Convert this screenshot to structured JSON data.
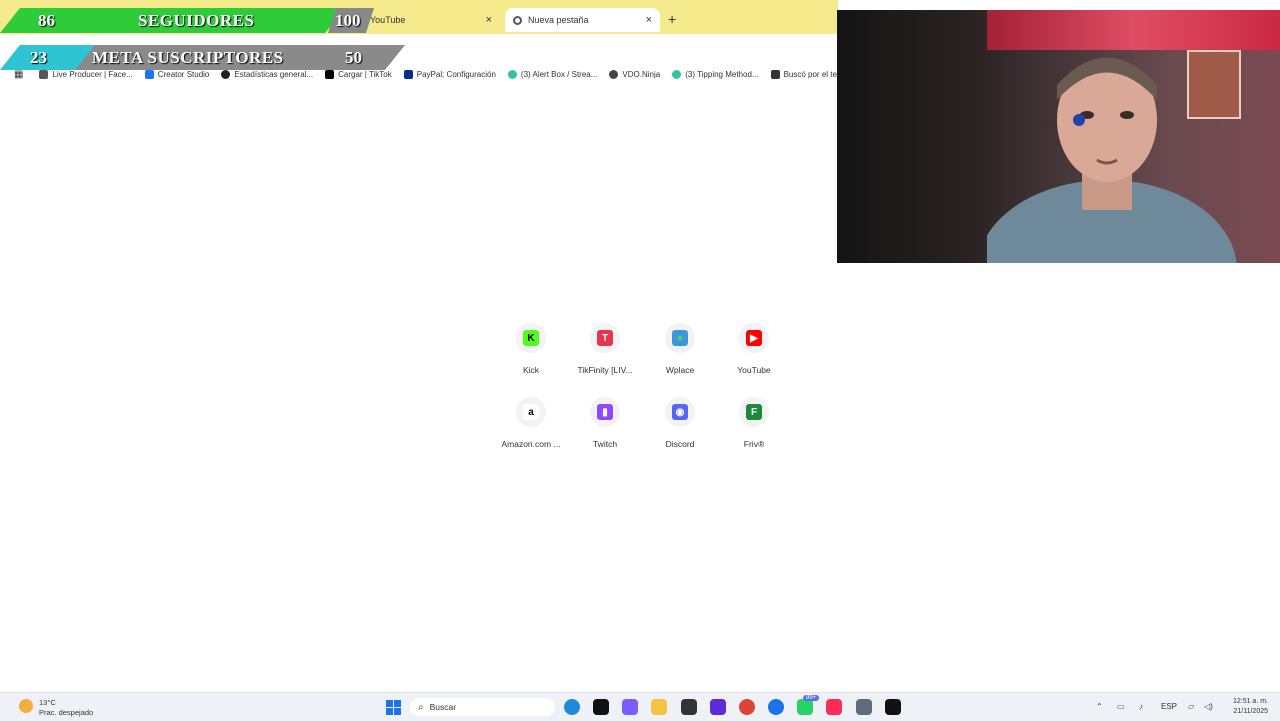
{
  "browser": {
    "tabs": [
      {
        "label": "YouTube",
        "active": false
      },
      {
        "label": "Nueva pestaña",
        "active": true
      }
    ],
    "new_tab_glyph": "+",
    "close_glyph": "×",
    "bookmarks": [
      {
        "label": "Live Producer | Face...",
        "color": "#555555"
      },
      {
        "label": "Creator Studio",
        "color": "#1877f2"
      },
      {
        "label": "Estadísticas general...",
        "color": "#222222"
      },
      {
        "label": "Cargar | TikTok",
        "color": "#000000"
      },
      {
        "label": "PayPal: Configuración",
        "color": "#003087"
      },
      {
        "label": "(3) Alert Box / Strea...",
        "color": "#31c3a2"
      },
      {
        "label": "VDO.Ninja",
        "color": "#444444"
      },
      {
        "label": "(3) Tipping Method...",
        "color": "#31c3a2"
      },
      {
        "label": "Buscó por el te",
        "color": "#333333"
      }
    ]
  },
  "overlay": {
    "followers": {
      "current": "86",
      "title": "SEGUIDORES",
      "goal": "100"
    },
    "subscribers": {
      "current": "23",
      "title": "META SUSCRIPTORES",
      "goal": "50"
    }
  },
  "shortcuts": [
    {
      "label": "Kick",
      "icon": "kick-icon",
      "color": "#53fc18",
      "glyph": "K",
      "glyph_color": "#000000"
    },
    {
      "label": "TikFinity [LIV...",
      "icon": "tikfinity-icon",
      "color": "#e8344e",
      "glyph": "T",
      "glyph_color": "#ffffff"
    },
    {
      "label": "Wplace",
      "icon": "globe-icon",
      "color": "#3a9ad9",
      "glyph": "●",
      "glyph_color": "#6ac46a"
    },
    {
      "label": "YouTube",
      "icon": "youtube-icon",
      "color": "#ff0000",
      "glyph": "▶",
      "glyph_color": "#ffffff"
    },
    {
      "label": "Amazon.com ...",
      "icon": "amazon-icon",
      "color": "#ffffff",
      "glyph": "a",
      "glyph_color": "#000000"
    },
    {
      "label": "Twitch",
      "icon": "twitch-icon",
      "color": "#9146ff",
      "glyph": "▮",
      "glyph_color": "#ffffff"
    },
    {
      "label": "Discord",
      "icon": "discord-icon",
      "color": "#5865f2",
      "glyph": "◉",
      "glyph_color": "#ffffff"
    },
    {
      "label": "Friv®",
      "icon": "friv-icon",
      "color": "#1a8a3a",
      "glyph": "F",
      "glyph_color": "#ffffff"
    }
  ],
  "taskbar": {
    "weather": {
      "temp": "13°C",
      "condition": "Prac. despejado"
    },
    "search_placeholder": "Buscar",
    "apps": [
      {
        "name": "edge",
        "color": "#1c8ad6"
      },
      {
        "name": "tiktok",
        "color": "#111111"
      },
      {
        "name": "copilot",
        "color": "#7a5cff"
      },
      {
        "name": "file-explorer",
        "color": "#f4c542"
      },
      {
        "name": "obs",
        "color": "#333333"
      },
      {
        "name": "streamlabs",
        "color": "#5a2bd6"
      },
      {
        "name": "chrome",
        "color": "#db4437"
      },
      {
        "name": "chrome-profile",
        "color": "#1a73e8"
      },
      {
        "name": "whatsapp",
        "color": "#25d366"
      },
      {
        "name": "tiktok-live-studio",
        "color": "#fe2c55"
      },
      {
        "name": "settings",
        "color": "#5f6b7a"
      },
      {
        "name": "tiktok-2",
        "color": "#111111"
      }
    ],
    "whatsapp_badge": "99+",
    "language": "ESP",
    "time": "12:51 a. m.",
    "date": "21/11/2025"
  }
}
